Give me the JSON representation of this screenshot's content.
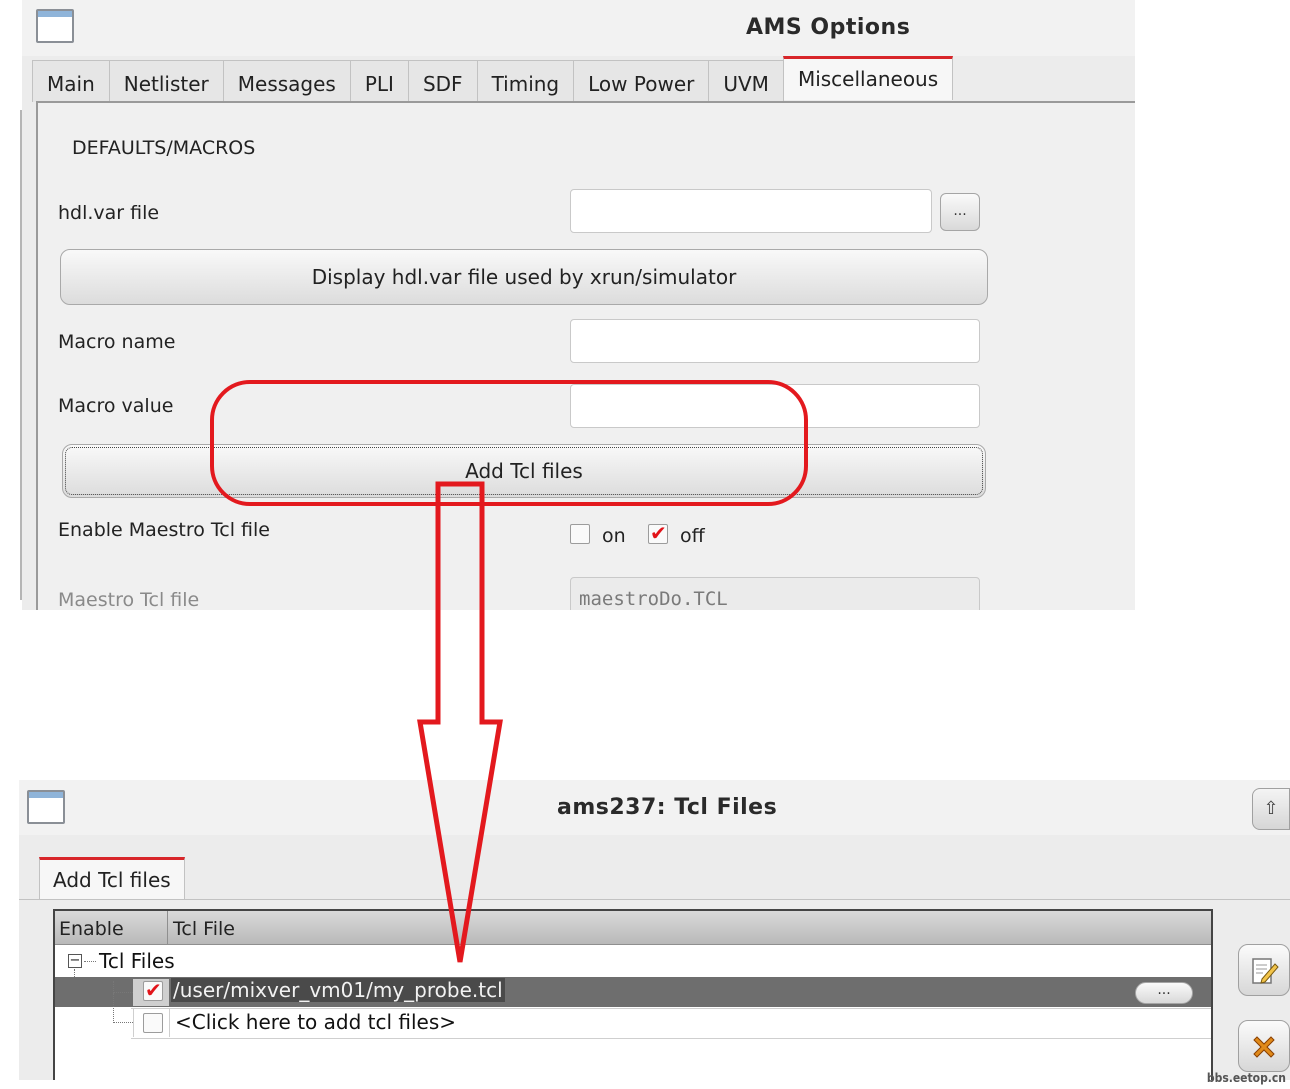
{
  "window1": {
    "title": "AMS Options",
    "tabs": [
      "Main",
      "Netlister",
      "Messages",
      "PLI",
      "SDF",
      "Timing",
      "Low Power",
      "UVM",
      "Miscellaneous"
    ],
    "active_tab": "Miscellaneous",
    "section_heading": "DEFAULTS/MACROS",
    "hdl_var_label": "hdl.var file",
    "hdl_var_value": "",
    "browse_label": "...",
    "display_button": "Display hdl.var file used by xrun/simulator",
    "macro_name_label": "Macro name",
    "macro_value_label": "Macro value",
    "add_tcl_button": "Add Tcl files",
    "enable_maestro_label": "Enable Maestro Tcl file",
    "on_label": "on",
    "off_label": "off",
    "maestro_tcl_label": "Maestro Tcl file",
    "maestro_tcl_value": "maestroDo.TCL"
  },
  "window2": {
    "title": "ams237: Tcl Files",
    "tab": "Add Tcl files",
    "columns": [
      "Enable",
      "Tcl File"
    ],
    "tree_root": "Tcl Files",
    "file_row": "/user/mixver_vm01/my_probe.tcl",
    "add_row": "<Click here to add tcl files>",
    "browse_label": "...",
    "up_icon": "up-arrow-icon",
    "edit_icon": "edit-icon",
    "delete_icon": "delete-icon"
  },
  "annotation_color": "#e3191e",
  "watermark": "bbs.eetop.cn"
}
